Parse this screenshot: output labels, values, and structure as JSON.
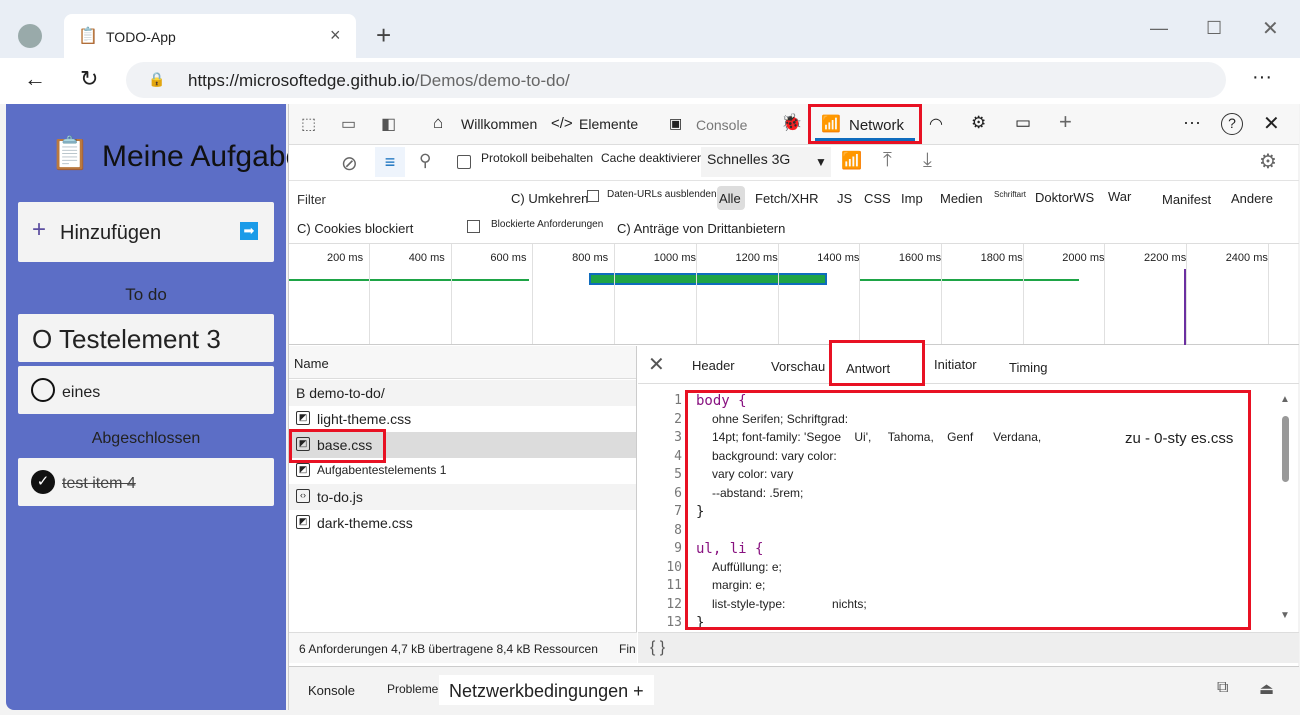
{
  "browser": {
    "tab_title": "TODO-App",
    "url_host": "https://microsoftedge.github.io",
    "url_path": "/Demos/demo-to-do/"
  },
  "app": {
    "title": "Meine Aufgaben",
    "add_label": "Hinzufügen",
    "todo_heading": "To do",
    "todo_items": [
      "O Testelement 3",
      "eines"
    ],
    "done_heading": "Abgeschlossen",
    "done_items": [
      "test item 4"
    ]
  },
  "devtools": {
    "tabs": [
      "Willkommen",
      "Elemente",
      "Console",
      "Network"
    ],
    "active_tab": "Network",
    "toolbar": {
      "preserve_log": "Protokoll beibehalten",
      "disable_cache": "Cache deaktivieren",
      "throttle": "Schnelles 3G"
    },
    "filter": {
      "placeholder": "Filter",
      "invert": "C) Umkehren",
      "hide_data_urls": "Daten-URLs ausblenden",
      "types": [
        "Alle",
        "Fetch/XHR",
        "JS",
        "CSS",
        "Imp",
        "Medien",
        "Schriftart",
        "DoktorWS",
        "War",
        "Manifest",
        "Andere"
      ],
      "active_type": "Alle",
      "blocked_cookies": "C) Cookies blockiert",
      "blocked_requests": "Blockierte Anforderungen",
      "third_party": "C) Anträge von Drittanbietern"
    },
    "timeline": {
      "ticks": [
        "200 ms",
        "400 ms",
        "600 ms",
        "800 ms",
        "1000 ms",
        "1200 ms",
        "1400 ms",
        "1600 ms",
        "1800 ms",
        "2000 ms",
        "2200 ms",
        "2400 ms"
      ]
    },
    "requests": {
      "header": "Name",
      "items": [
        {
          "name": "B demo-to-do/",
          "icon": "document-icon"
        },
        {
          "name": "light-theme.css",
          "icon": "css-icon"
        },
        {
          "name": "base.css",
          "icon": "css-icon"
        },
        {
          "name": "Aufgabentestelements 1",
          "icon": "css-icon"
        },
        {
          "name": "to-do.js",
          "icon": "script-icon"
        },
        {
          "name": "dark-theme.css",
          "icon": "css-icon"
        }
      ],
      "selected": "base.css"
    },
    "status": "6 Anforderungen 4,7 kB übertragene 8,4 kB Ressourcen",
    "status_more": "Fin",
    "detail_tabs": [
      "Header",
      "Vorschau",
      "Antwort",
      "Initiator",
      "Timing"
    ],
    "active_detail_tab": "Antwort",
    "response_lines": [
      "body {",
      "ohne Serifen; Schriftgrad:",
      "14pt; font-family: 'Segoe    Ui',     Tahoma,    Genf      Verdana,",
      "background: vary color:",
      "vary color: vary",
      "--abstand: .5rem;",
      "}",
      "",
      "ul, li {",
      "Auffüllung: e;",
      "margin: e;",
      "list-style-type:              nichts;",
      "}"
    ],
    "response_overlay": "zu - 0-sty es.css",
    "pretty_print": "{ }",
    "drawer_tabs": [
      "Konsole",
      "Probleme",
      "Netzwerkbedingungen +"
    ]
  },
  "colors": {
    "app_bg": "#5c6ec6",
    "highlight": "#e81123",
    "active_underline": "#0f6cbd"
  }
}
